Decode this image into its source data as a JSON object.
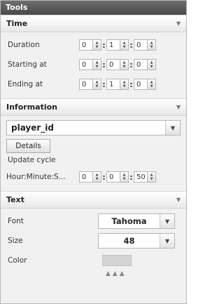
{
  "window": {
    "title": "Tools"
  },
  "sections": {
    "time": {
      "title": "Time",
      "rows": [
        {
          "label": "Duration",
          "values": [
            "0",
            "1",
            "0"
          ]
        },
        {
          "label": "Starting at",
          "values": [
            "0",
            "0",
            "0"
          ]
        },
        {
          "label": "Ending at",
          "values": [
            "0",
            "1",
            "0"
          ]
        }
      ]
    },
    "information": {
      "title": "Information",
      "select_value": "player_id",
      "details_button": "Details",
      "update_cycle_label": "Update cycle",
      "hms_label": "Hour:Minute:S...",
      "hms_values": [
        "0",
        "0",
        "50"
      ]
    },
    "text": {
      "title": "Text",
      "font_label": "Font",
      "font_value": "Tahoma",
      "size_label": "Size",
      "size_value": "48",
      "color_label": "Color"
    }
  },
  "colors": {
    "titlebar": "#5a5a5a",
    "panel_bg": "#f1f1f1",
    "swatch": "#d4d4d4"
  },
  "icons": {
    "collapse": "triangle-down-icon",
    "spinner": "spinner-arrows-icon",
    "dropdown": "chevron-down-icon"
  }
}
